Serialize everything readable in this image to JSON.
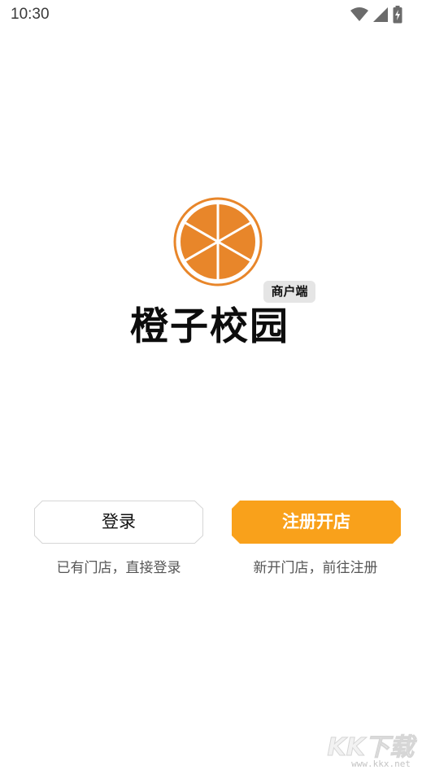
{
  "status_bar": {
    "time": "10:30",
    "icons": [
      "wifi-icon",
      "signal-icon",
      "battery-charging-icon"
    ]
  },
  "brand": {
    "app_name": "橙子校园",
    "badge": "商户端",
    "logo_icon": "orange-slice-icon",
    "colors": {
      "orange": "#e8862a",
      "orange_ring": "#e8862a",
      "accent": "#f9a11b"
    }
  },
  "actions": {
    "login": {
      "label": "登录",
      "hint": "已有门店，直接登录"
    },
    "register": {
      "label": "注册开店",
      "hint": "新开门店，前往注册"
    }
  },
  "watermark": {
    "brand": "KK下载",
    "url": "www.kkx.net"
  }
}
